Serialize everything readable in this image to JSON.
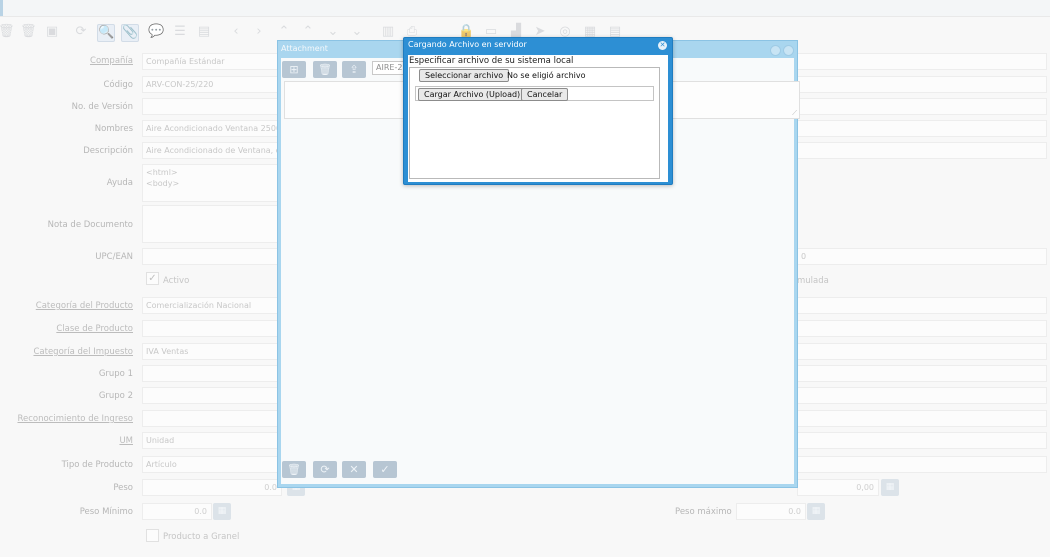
{
  "form": {
    "company_label": "Compañía",
    "company_value": "Compañía Estándar",
    "code_label": "Código",
    "code_value": "ARV-CON-25/220",
    "version_label": "No. de Versión",
    "version_value": "",
    "name_label": "Nombres",
    "name_value": "Aire Acondicionado Ventana 2500",
    "description_label": "Descripción",
    "description_value": "Aire Acondicionado de Ventana, d",
    "help_label": "Ayuda",
    "help_value": "<html>\n<body>",
    "doc_note_label": "Nota de Documento",
    "doc_note_value": "",
    "upc_label": "UPC/EAN",
    "upc_value": "",
    "active_label": "Activo",
    "product_category_label": "Categoría del Producto",
    "product_category_value": "Comercialización Nacional",
    "product_class_label": "Clase de Producto",
    "product_class_value": "",
    "tax_category_label": "Categoría del Impuesto",
    "tax_category_value": "IVA Ventas",
    "group1_label": "Grupo 1",
    "group1_value": "",
    "group2_label": "Grupo 2",
    "group2_value": "",
    "revenue_label": "Reconocimiento de Ingreso",
    "revenue_value": "",
    "uom_label": "UM",
    "uom_value": "Unidad",
    "product_type_label": "Tipo de Producto",
    "product_type_value": "Artículo",
    "weight_label": "Peso",
    "weight_value": "0.0",
    "min_weight_label": "Peso Mínimo",
    "min_weight_value": "0.0",
    "max_weight_label": "Peso máximo",
    "max_weight_value": "0.0",
    "right_number_value": "0,00",
    "right_upc_partial": "0",
    "accumulated_label": "mulada",
    "bulk_label": "Producto a Granel"
  },
  "attachment": {
    "title": "Attachment",
    "filename": "AIRE-2"
  },
  "upload": {
    "title": "Cargando Archivo en servidor",
    "instruction": "Especificar archivo de su sistema local",
    "select_button": "Seleccionar archivo",
    "no_file": "No se eligió archivo",
    "upload_button": "Cargar Archivo (Upload)",
    "cancel_button": "Cancelar"
  }
}
